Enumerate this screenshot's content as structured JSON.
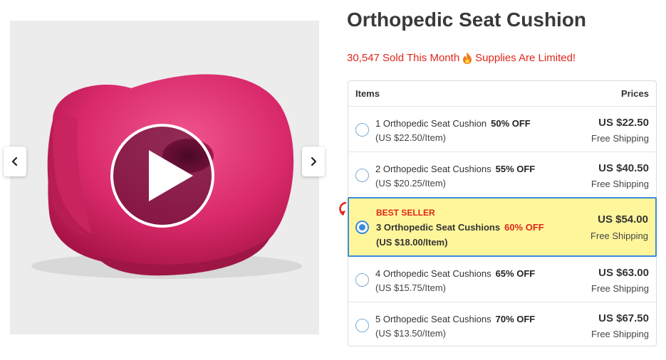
{
  "product": {
    "title": "Orthopedic Seat Cushion",
    "sold_text": "30,547 Sold This Month",
    "limited_text": "Supplies Are Limited!"
  },
  "gallery": {
    "play_icon": "play-icon",
    "prev_icon": "chevron-left-icon",
    "next_icon": "chevron-right-icon"
  },
  "table": {
    "col_items": "Items",
    "col_prices": "Prices",
    "rows": [
      {
        "name": "1 Orthopedic Seat Cushion",
        "discount": "50% OFF",
        "per_item": "(US $22.50/Item)",
        "price": "US $22.50",
        "shipping": "Free Shipping",
        "selected": false
      },
      {
        "name": "2 Orthopedic Seat Cushions",
        "discount": "55% OFF",
        "per_item": "(US $20.25/Item)",
        "price": "US $40.50",
        "shipping": "Free Shipping",
        "selected": false
      },
      {
        "badge": "BEST SELLER",
        "name": "3 Orthopedic Seat Cushions",
        "discount": "60% OFF",
        "per_item": "(US $18.00/Item)",
        "price": "US $54.00",
        "shipping": "Free Shipping",
        "selected": true
      },
      {
        "name": "4 Orthopedic Seat Cushions",
        "discount": "65% OFF",
        "per_item": "(US $15.75/Item)",
        "price": "US $63.00",
        "shipping": "Free Shipping",
        "selected": false
      },
      {
        "name": "5 Orthopedic Seat Cushions",
        "discount": "70% OFF",
        "per_item": "(US $13.50/Item)",
        "price": "US $67.50",
        "shipping": "Free Shipping",
        "selected": false
      }
    ]
  },
  "colors": {
    "accent_red": "#e0261b",
    "highlight_yellow": "#fff69b",
    "select_blue": "#3c8bd9",
    "cushion_pink": "#d9296a"
  }
}
